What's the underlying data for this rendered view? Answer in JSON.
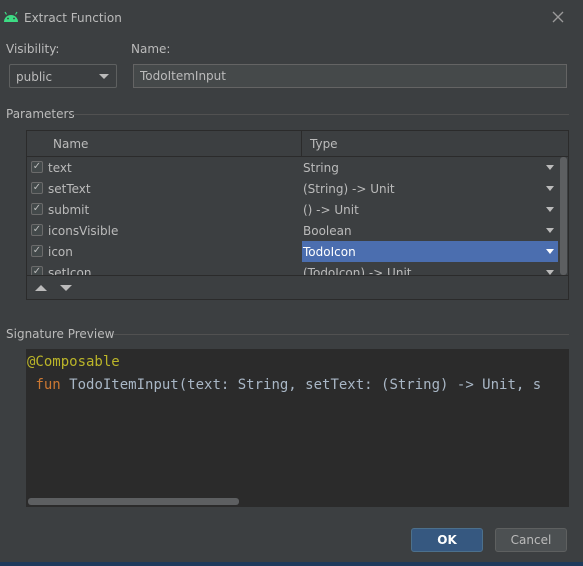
{
  "window": {
    "title": "Extract Function"
  },
  "visibility": {
    "label": "Visibility:",
    "value": "public"
  },
  "name": {
    "label": "Name:",
    "value": "TodoItemInput"
  },
  "parameters": {
    "section_label": "Parameters",
    "columns": {
      "name": "Name",
      "type": "Type"
    },
    "rows": [
      {
        "name": "text",
        "type": "String",
        "checked": true
      },
      {
        "name": "setText",
        "type": "(String) -> Unit",
        "checked": true
      },
      {
        "name": "submit",
        "type": "() -> Unit",
        "checked": true
      },
      {
        "name": "iconsVisible",
        "type": "Boolean",
        "checked": true
      },
      {
        "name": "icon",
        "type": "TodoIcon",
        "checked": true,
        "selected": true
      },
      {
        "name": "setIcon",
        "type": "(TodoIcon) -> Unit",
        "checked": true
      }
    ]
  },
  "signature": {
    "section_label": "Signature Preview",
    "annotation": "@Composable",
    "keyword": "fun",
    "signature_rest": " TodoItemInput(text: String, setText: (String) -> Unit, s"
  },
  "buttons": {
    "ok": "OK",
    "cancel": "Cancel"
  },
  "colors": {
    "background": "#3c3f41",
    "selection": "#4b6eaf",
    "ok_button": "#365880",
    "editor_bg": "#2b2b2b"
  }
}
